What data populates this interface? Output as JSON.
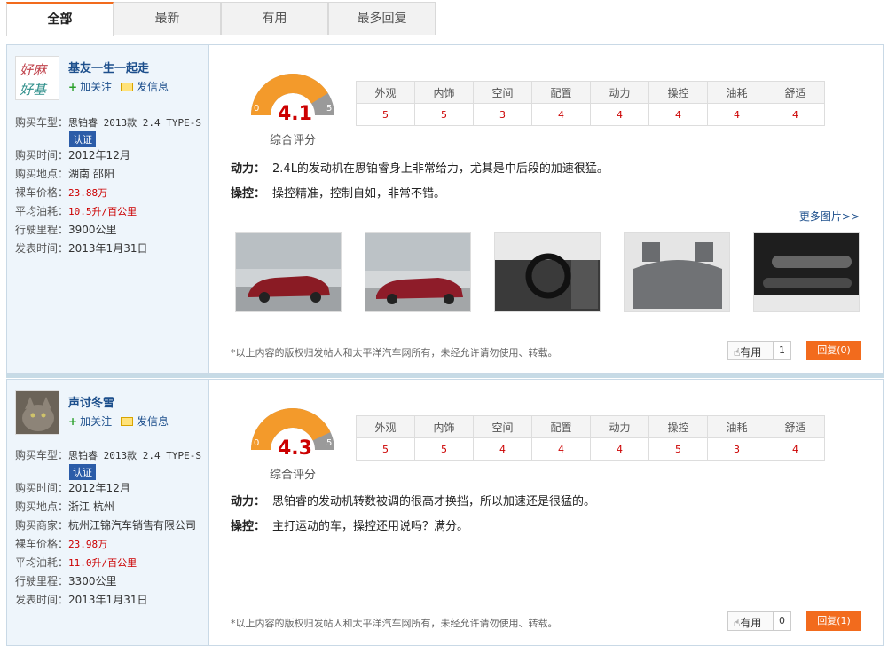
{
  "tabs": [
    {
      "label": "全部",
      "active": true
    },
    {
      "label": "最新",
      "active": false
    },
    {
      "label": "有用",
      "active": false
    },
    {
      "label": "最多回复",
      "active": false
    }
  ],
  "rating_headers": [
    "外观",
    "内饰",
    "空间",
    "配置",
    "动力",
    "操控",
    "油耗",
    "舒适"
  ],
  "score_label": "综合评分",
  "gauge_min": "0",
  "gauge_max": "5",
  "reviews": [
    {
      "user": "基友一生一起走",
      "follow": "加关注",
      "message": "发信息",
      "car_label": "购买车型：",
      "car": "思铂睿 2013款 2.4 TYPE-S",
      "verified": "认证",
      "time_label": "购买时间：",
      "time": "2012年12月",
      "place_label": "购买地点：",
      "place": "湖南 邵阳",
      "price_label": "裸车价格：",
      "price": "23.88万",
      "fuel_label": "平均油耗：",
      "fuel": "10.5升/百公里",
      "mileage_label": "行驶里程：",
      "mileage": "3900公里",
      "posted_label": "发表时间：",
      "posted": "2013年1月31日",
      "score": "4.1",
      "score_value": 4.1,
      "ratings": [
        "5",
        "5",
        "3",
        "4",
        "4",
        "4",
        "4",
        "4"
      ],
      "power_label": "动力：",
      "power": "2.4L的发动机在思铂睿身上非常给力，尤其是中后段的加速很猛。",
      "handling_label": "操控：",
      "handling": "操控精准，控制自如，非常不错。",
      "more_photos": "更多图片>>",
      "copyright": "*以上内容的版权归发帖人和太平洋汽车网所有，未经允许请勿使用、转载。",
      "useful_label": "有用",
      "useful_count": "1",
      "reply": "回复(0)"
    },
    {
      "user": "声讨冬雪",
      "follow": "加关注",
      "message": "发信息",
      "car_label": "购买车型：",
      "car": "思铂睿 2013款 2.4 TYPE-S",
      "verified": "认证",
      "time_label": "购买时间：",
      "time": "2012年12月",
      "place_label": "购买地点：",
      "place": "浙江 杭州",
      "dealer_label": "购买商家：",
      "dealer": "杭州江锦汽车销售有限公司",
      "price_label": "裸车价格：",
      "price": "23.98万",
      "fuel_label": "平均油耗：",
      "fuel": "11.0升/百公里",
      "mileage_label": "行驶里程：",
      "mileage": "3300公里",
      "posted_label": "发表时间：",
      "posted": "2013年1月31日",
      "score": "4.3",
      "score_value": 4.3,
      "ratings": [
        "5",
        "5",
        "4",
        "4",
        "4",
        "5",
        "3",
        "4"
      ],
      "power_label": "动力：",
      "power": "思铂睿的发动机转数被调的很高才换挡，所以加速还是很猛的。",
      "handling_label": "操控：",
      "handling": "主打运动的车，操控还用说吗？满分。",
      "copyright": "*以上内容的版权归发帖人和太平洋汽车网所有，未经允许请勿使用、转载。",
      "useful_label": "有用",
      "useful_count": "0",
      "reply": "回复(1)"
    }
  ],
  "colors": {
    "accent": "#f26b1d",
    "link": "#1d4f8c",
    "score_red": "#cc0000",
    "gauge_orange": "#f39a2b",
    "gauge_gray": "#999999"
  },
  "icons": [
    "thumbs-up-icon",
    "envelope-icon",
    "plus-icon",
    "gauge-icon"
  ]
}
